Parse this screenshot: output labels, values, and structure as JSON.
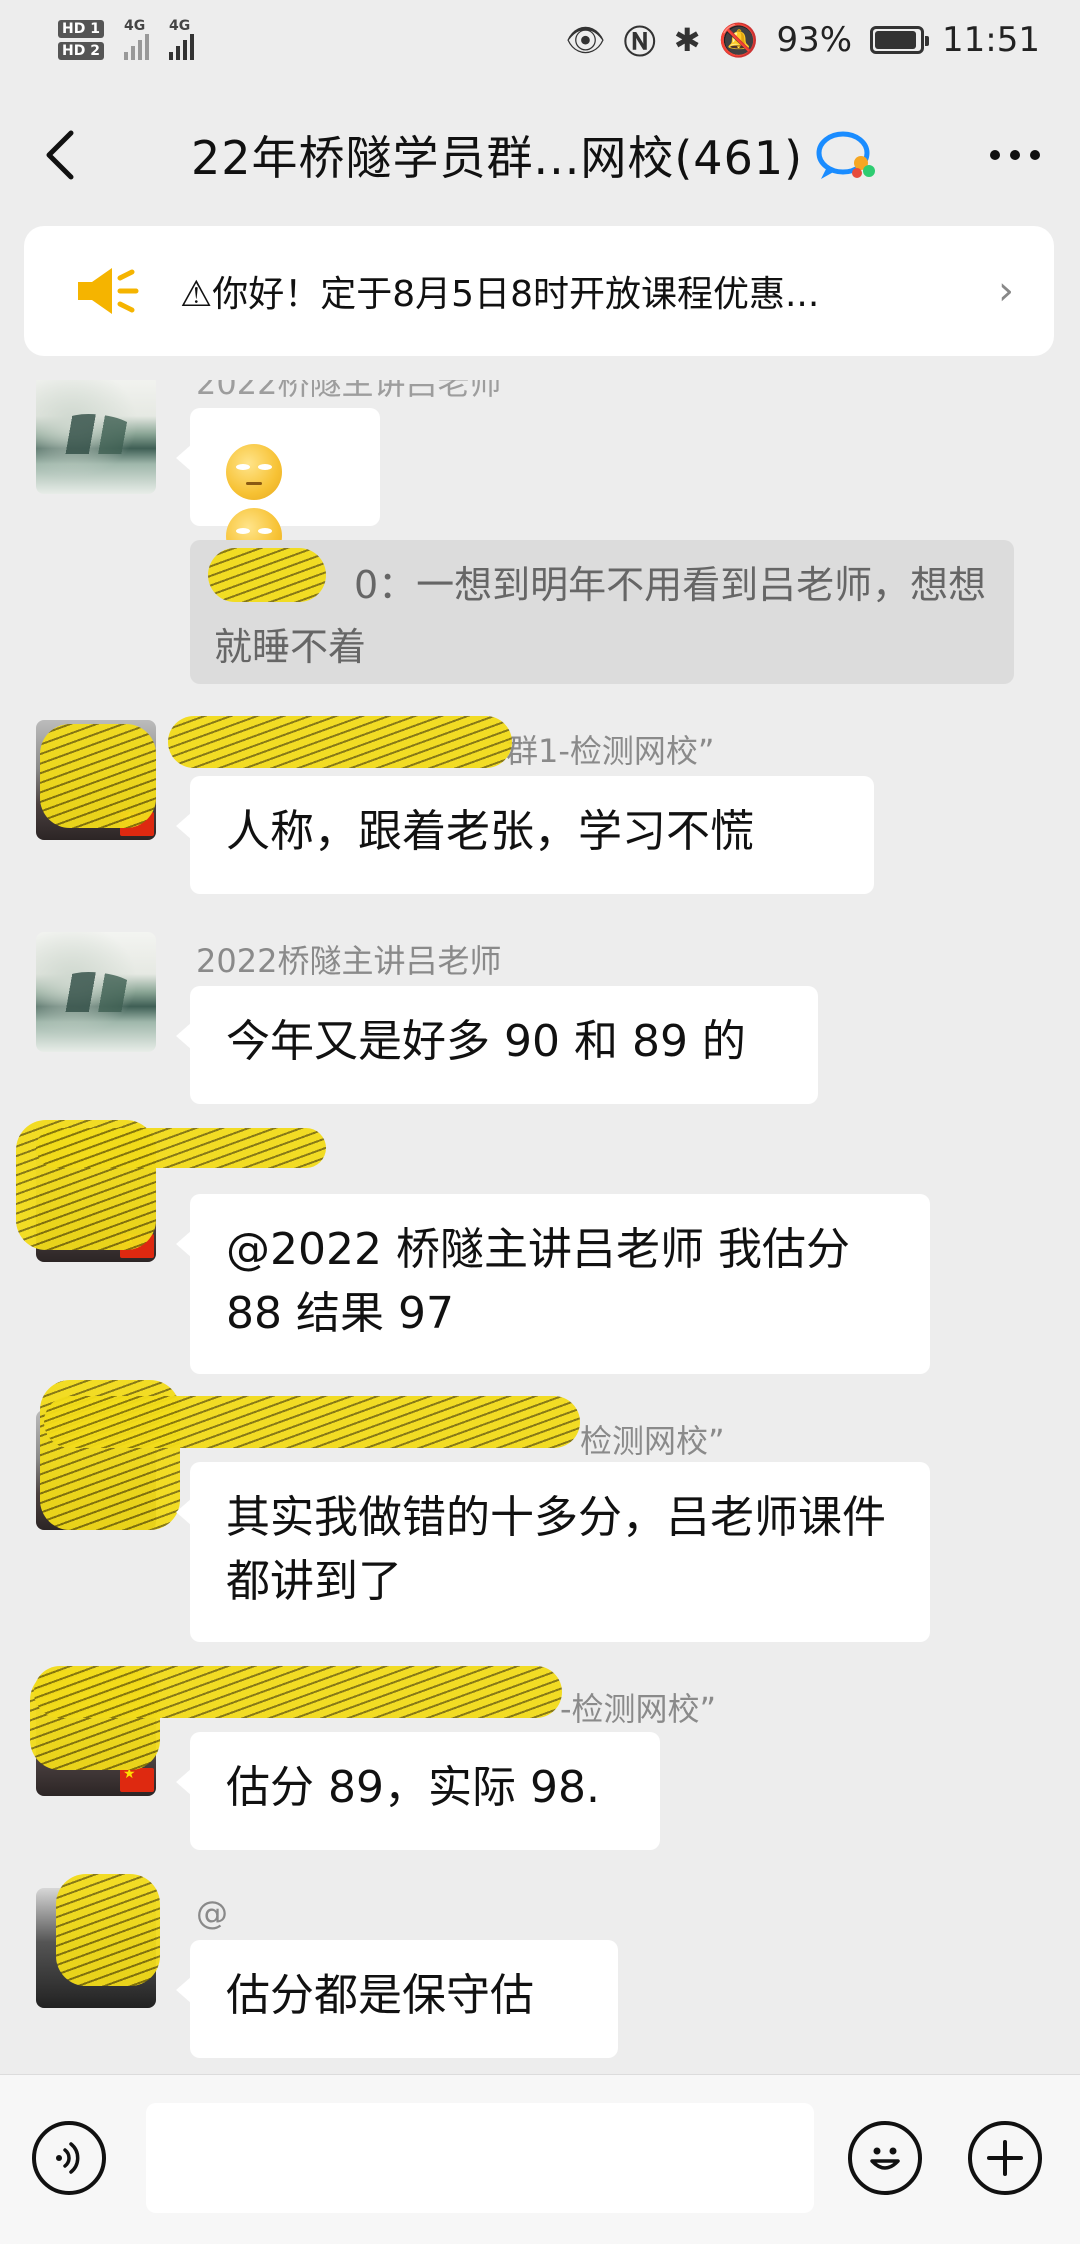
{
  "status_bar": {
    "hd1": "HD 1",
    "hd2": "HD 2",
    "net1": "4G",
    "net2": "4G",
    "battery": "93%",
    "time": "11:51",
    "battery_level": 0.93
  },
  "header": {
    "title": "22年桥隧学员群...网校(461)"
  },
  "notice": {
    "text": "⚠你好！定于8月5日8时开放课程优惠..."
  },
  "messages": [
    {
      "sender": "2022桥隧主讲吕老师",
      "avatar": "landscape"
    },
    {
      "quote_suffix": "0：一想到明年不用看到吕老师，想想就睡不着"
    },
    {
      "sender_suffix": "群1-检测网校”",
      "text": "人称，跟着老张，学习不慌"
    },
    {
      "sender": "2022桥隧主讲吕老师",
      "text": "今年又是好多 90 和 89 的"
    },
    {
      "text": "@2022 桥隧主讲吕老师  我估分 88 结果 97"
    },
    {
      "sender_suffix": "检测网校”",
      "text": "其实我做错的十多分，吕老师课件都讲到了"
    },
    {
      "sender_suffix": "-检测网校”",
      "text": "估分 89，实际 98."
    },
    {
      "sender": "@",
      "text": "估分都是保守估"
    }
  ]
}
